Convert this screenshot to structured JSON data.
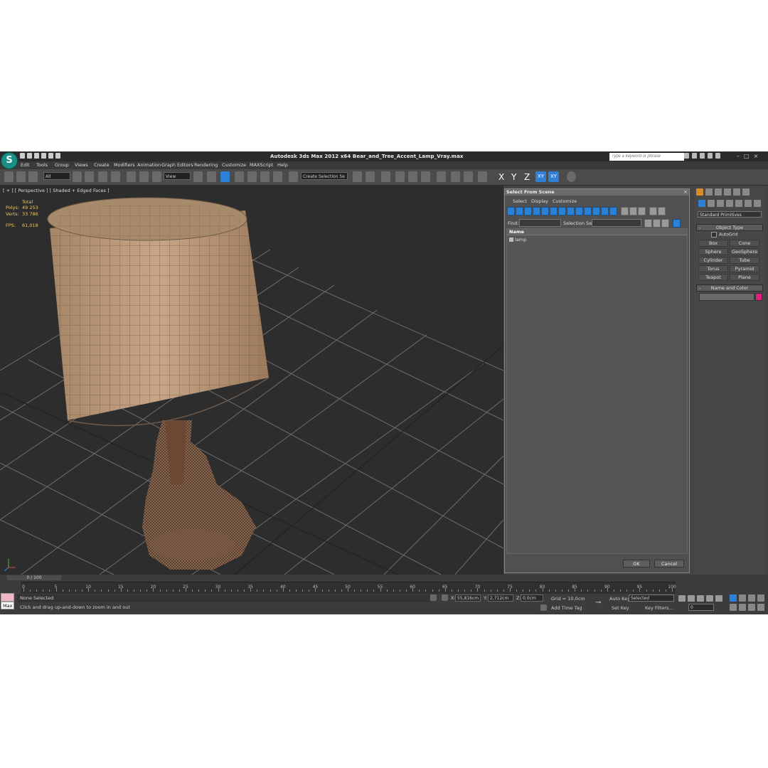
{
  "app": {
    "title": "Autodesk 3ds Max  2012 x64     Bear_and_Tree_Accent_Lamp_Vray.max",
    "search_placeholder": "Type a keyword or phrase",
    "logo": "3ds-max-logo"
  },
  "menu": [
    "Edit",
    "Tools",
    "Group",
    "Views",
    "Create",
    "Modifiers",
    "Animation",
    "Graph Editors",
    "Rendering",
    "Customize",
    "MAXScript",
    "Help"
  ],
  "toolbar": {
    "filter_value": "All",
    "ref_coord_value": "View",
    "selection_set_placeholder": "Create Selection Se",
    "axes": [
      "X",
      "Y",
      "Z",
      "XY",
      "XY"
    ]
  },
  "viewport": {
    "label": "[ + ] [ Perspective ] [ Shaded + Edged Faces ]",
    "stats": {
      "header": "Total",
      "polys_label": "Polys:",
      "polys_value": "49 253",
      "verts_label": "Verts:",
      "verts_value": "33 786",
      "fps_label": "FPS:",
      "fps_value": "61,018"
    }
  },
  "dialog": {
    "title": "Select From Scene",
    "menu": [
      "Select",
      "Display",
      "Customize"
    ],
    "find_label": "Find:",
    "selection_set_label": "Selection Set:",
    "column_name": "Name",
    "items": [
      "lamp"
    ],
    "ok": "OK",
    "cancel": "Cancel"
  },
  "command_panel": {
    "category": "Standard Primitives",
    "object_type": "Object Type",
    "autogrid": "AutoGrid",
    "primitives": [
      "Box",
      "Cone",
      "Sphere",
      "GeoSphere",
      "Cylinder",
      "Tube",
      "Torus",
      "Pyramid",
      "Teapot",
      "Plane"
    ],
    "name_and_color": "Name and Color",
    "object_color": "#e0207b"
  },
  "timeline": {
    "frame": "0 / 100",
    "ticks": [
      "0",
      "5",
      "10",
      "15",
      "20",
      "25",
      "30",
      "35",
      "40",
      "45",
      "50",
      "55",
      "60",
      "65",
      "70",
      "75",
      "80",
      "85",
      "90",
      "95",
      "100"
    ]
  },
  "status": {
    "selection": "None Selected",
    "prompt": "Click and drag up-and-down to zoom in and out",
    "maxscript": "Max",
    "x_label": "X:",
    "x_value": "55,816cm",
    "y_label": "Y:",
    "y_value": "2,712cm",
    "z_label": "Z:",
    "z_value": "0,0cm",
    "grid": "Grid = 10,0cm",
    "auto_key": "Auto Key",
    "selected": "Selected",
    "add_time_tag": "Add Time Tag",
    "set_key": "Set Key",
    "key_filters": "Key Filters...",
    "frame_value": "0"
  }
}
